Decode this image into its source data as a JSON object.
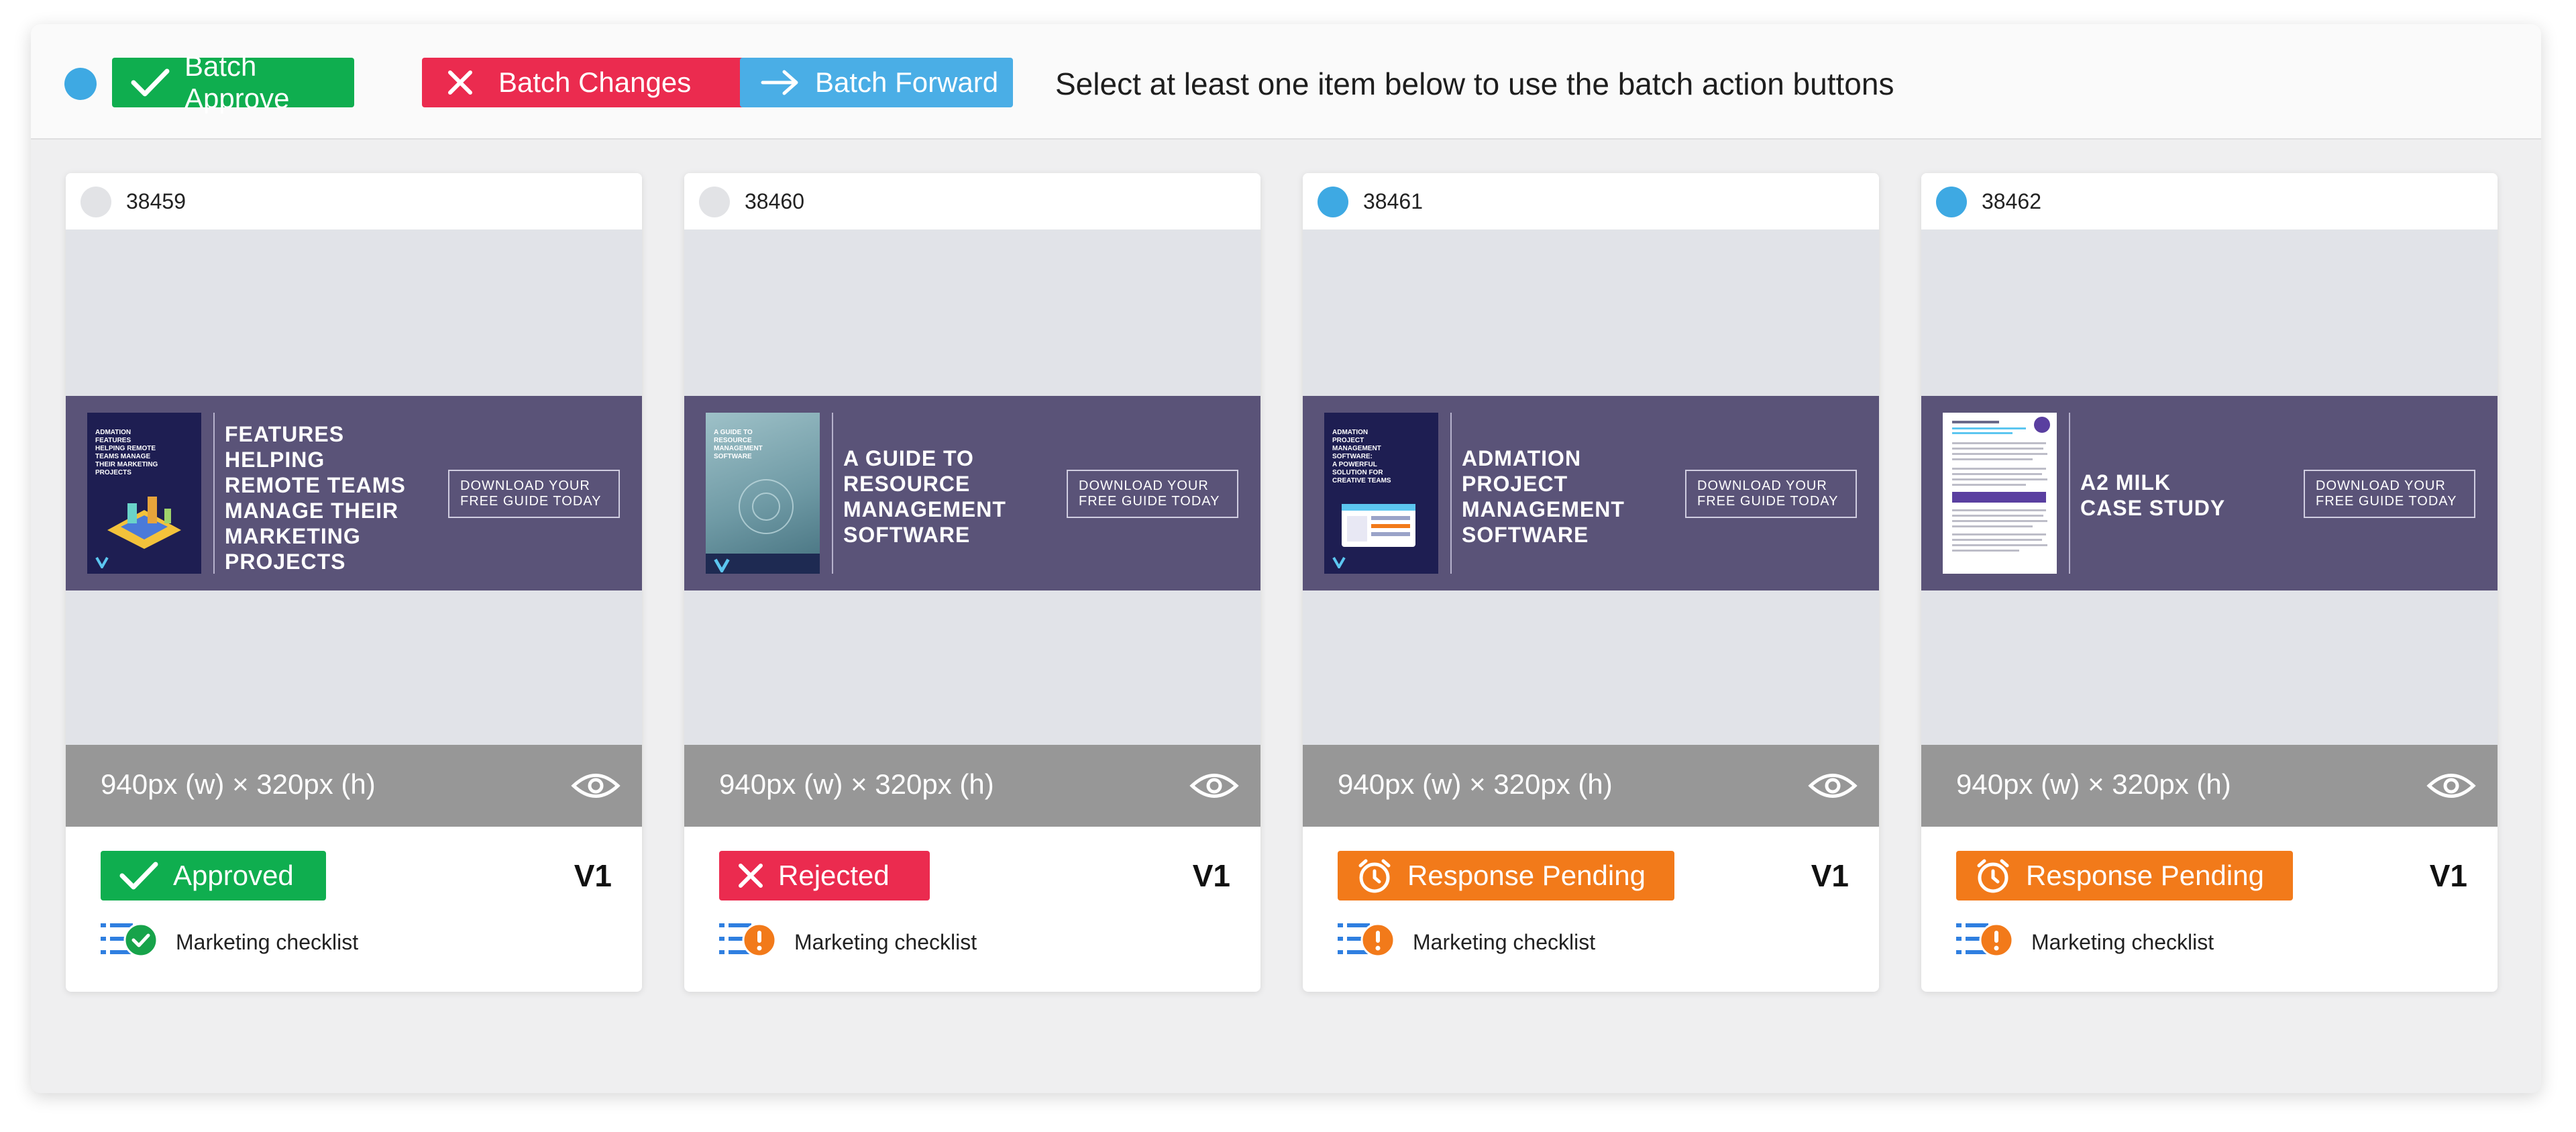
{
  "toolbar": {
    "approve_label": "Batch Approve",
    "changes_label": "Batch Changes",
    "forward_label": "Batch Forward",
    "hint": "Select at least one item below to use the batch action buttons"
  },
  "colors": {
    "select_dot": "#3ea9e3",
    "approved": "#0fae4f",
    "rejected": "#eb2b4f",
    "forward": "#4aaee6",
    "pending": "#f27a1a",
    "banner": "#5a5378"
  },
  "cards": [
    {
      "id": "38459",
      "selected": false,
      "cover_text": "ADMATION\nFEATURES\nHELPING REMOTE\nTEAMS MANAGE\nTHEIR MARKETING\nPROJECTS",
      "banner_title": "FEATURES\nHELPING\nREMOTE TEAMS\nMANAGE THEIR\nMARKETING\nPROJECTS",
      "cta": "DOWNLOAD YOUR\nFREE GUIDE TODAY",
      "dimensions": "940px (w) × 320px (h)",
      "status": "Approved",
      "status_icon": "check-icon",
      "version": "V1",
      "checklist": "Marketing checklist",
      "checklist_state": "complete"
    },
    {
      "id": "38460",
      "selected": false,
      "cover_text": "A GUIDE TO\nRESOURCE\nMANAGEMENT\nSOFTWARE",
      "banner_title": "A GUIDE TO\nRESOURCE\nMANAGEMENT\nSOFTWARE",
      "cta": "DOWNLOAD YOUR\nFREE GUIDE TODAY",
      "dimensions": "940px (w) × 320px (h)",
      "status": "Rejected",
      "status_icon": "close-icon",
      "version": "V1",
      "checklist": "Marketing checklist",
      "checklist_state": "warning"
    },
    {
      "id": "38461",
      "selected": true,
      "cover_text": "ADMATION\nPROJECT\nMANAGEMENT\nSOFTWARE:\nA POWERFUL\nSOLUTION FOR\nCREATIVE TEAMS",
      "banner_title": "ADMATION\nPROJECT\nMANAGEMENT\nSOFTWARE",
      "cta": "DOWNLOAD YOUR\nFREE GUIDE TODAY",
      "dimensions": "940px (w) × 320px (h)",
      "status": "Response Pending",
      "status_icon": "stopwatch-icon",
      "version": "V1",
      "checklist": "Marketing checklist",
      "checklist_state": "warning"
    },
    {
      "id": "38462",
      "selected": true,
      "cover_text": "",
      "banner_title": "A2 MILK\nCASE STUDY",
      "cta": "DOWNLOAD YOUR\nFREE GUIDE TODAY",
      "dimensions": "940px (w) × 320px (h)",
      "status": "Response Pending",
      "status_icon": "stopwatch-icon",
      "version": "V1",
      "checklist": "Marketing checklist",
      "checklist_state": "warning"
    }
  ]
}
